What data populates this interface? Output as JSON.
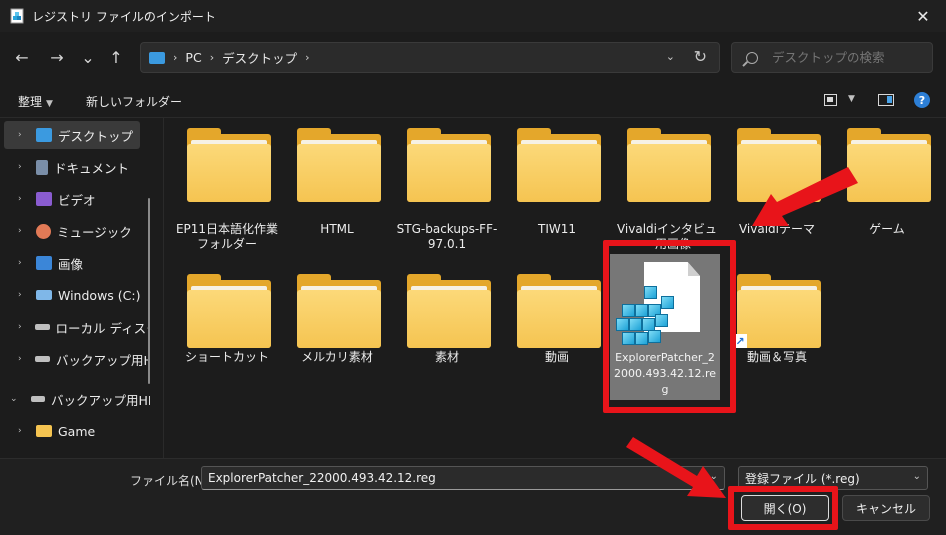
{
  "window": {
    "title": "レジストリ ファイルのインポート",
    "close_glyph": "✕"
  },
  "nav": {
    "back": "←",
    "forward": "→",
    "recent": "⌄",
    "up": "↑"
  },
  "address": {
    "segments": [
      "PC",
      "デスクトップ"
    ],
    "sep": "›",
    "dropdown": "⌄",
    "refresh": "↻"
  },
  "search": {
    "placeholder": "デスクトップの検索"
  },
  "toolbar": {
    "organize": "整理",
    "organize_caret": "▼",
    "new_folder": "新しいフォルダー",
    "view_caret": "▼",
    "help": "?"
  },
  "sidebar": {
    "items": [
      {
        "label": "デスクトップ",
        "icon": "desktop-icon",
        "color": "#3b9ae0",
        "selected": true
      },
      {
        "label": "ドキュメント",
        "icon": "document-icon",
        "color": "#7a8ea8"
      },
      {
        "label": "ビデオ",
        "icon": "video-icon",
        "color": "#8a5cd0"
      },
      {
        "label": "ミュージック",
        "icon": "music-icon",
        "color": "#e27a56"
      },
      {
        "label": "画像",
        "icon": "pictures-icon",
        "color": "#3b86d8"
      },
      {
        "label": "Windows (C:)",
        "icon": "drive-c-icon",
        "color": "#7fb7e8"
      },
      {
        "label": "ローカル ディスク",
        "icon": "drive-icon",
        "color": "#bfbfbf"
      },
      {
        "label": "バックアップ用HI",
        "icon": "drive-icon",
        "color": "#bfbfbf"
      },
      {
        "label": "バックアップ用HDI",
        "icon": "drive-icon",
        "color": "#bfbfbf",
        "expanded": true
      },
      {
        "label": "Game",
        "icon": "folder-icon",
        "color": "#f5c451"
      }
    ],
    "chev_right": "›",
    "chev_down": "⌄"
  },
  "files": {
    "row1": [
      "EP11日本語化作業フォルダー",
      "HTML",
      "STG-backups-FF-97.0.1",
      "TIW11",
      "Vivaldiインタビュー用画像",
      "Vivaldiテーマ",
      "ゲーム"
    ],
    "row2": [
      "ショートカット",
      "メルカリ素材",
      "素材",
      "動画"
    ],
    "reg_file": "ExplorerPatcher_22000.493.42.12.reg",
    "last": "動画＆写真",
    "shortcut_arrow": "↗"
  },
  "bottom": {
    "filename_label": "ファイル名(N):",
    "filename_value": "ExplorerPatcher_22000.493.42.12.reg",
    "filetype_value": "登録ファイル (*.reg)",
    "dd": "⌄",
    "open_button": "開く(O)",
    "cancel_button": "キャンセル"
  },
  "colors": {
    "highlight": "#e8141a",
    "folder_light": "#fcd979",
    "folder_dark": "#e4a72b",
    "accent_blue": "#2d7fd6"
  }
}
